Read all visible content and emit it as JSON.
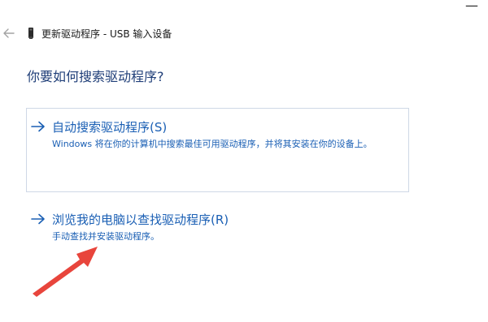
{
  "window": {
    "close_glyph": "—",
    "back_icon": "back-arrow-icon",
    "device_icon": "usb-device-icon",
    "title": "更新驱动程序 - USB 输入设备"
  },
  "main": {
    "heading": "你要如何搜索驱动程序?",
    "options": [
      {
        "label": "自动搜索驱动程序(S)",
        "description": "Windows 将在你的计算机中搜索最佳可用驱动程序，并将其安装在你的设备上。",
        "icon": "right-arrow-icon"
      },
      {
        "label": "浏览我的电脑以查找驱动程序(R)",
        "description": "手动查找并安装驱动程序。",
        "icon": "right-arrow-icon"
      }
    ]
  },
  "annotation": {
    "icon": "red-pointer-arrow-icon",
    "color": "#e8453c"
  },
  "colors": {
    "heading": "#1f3e78",
    "link": "#1a5fb4",
    "box_border": "#cfd8e6"
  }
}
